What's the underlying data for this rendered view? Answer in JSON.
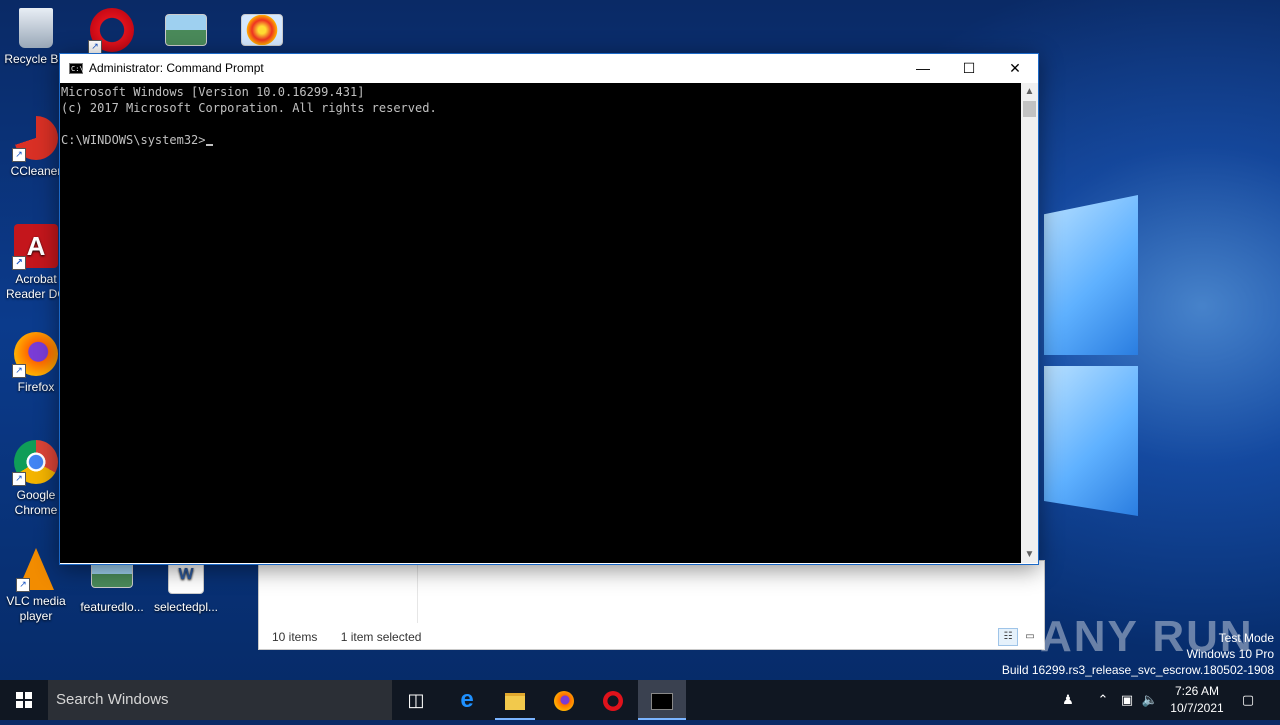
{
  "desktop": {
    "icons": [
      {
        "label": "Recycle Bin",
        "icon": "recycle-bin-icon"
      },
      {
        "label": "CCleaner",
        "icon": "ccleaner-icon"
      },
      {
        "label": "Acrobat Reader DC",
        "icon": "acrobat-reader-icon"
      },
      {
        "label": "Firefox",
        "icon": "firefox-icon"
      },
      {
        "label": "Google Chrome",
        "icon": "chrome-icon"
      },
      {
        "label": "VLC media player",
        "icon": "vlc-icon"
      },
      {
        "label": "featuredlo...",
        "icon": "image-file-icon"
      },
      {
        "label": "selectedpl...",
        "icon": "word-document-icon"
      }
    ]
  },
  "cmd": {
    "title": "Administrator: Command Prompt",
    "line1": "Microsoft Windows [Version 10.0.16299.431]",
    "line2": "(c) 2017 Microsoft Corporation. All rights reserved.",
    "prompt": "C:\\WINDOWS\\system32>"
  },
  "explorer": {
    "items_count": "10 items",
    "selected": "1 item selected"
  },
  "watermark": {
    "brand": "ANY RUN",
    "mode": "Test Mode",
    "edition": "Windows 10 Pro",
    "build": "Build 16299.rs3_release_svc_escrow.180502-1908"
  },
  "taskbar": {
    "search_placeholder": "Search Windows",
    "time": "7:26 AM",
    "date": "10/7/2021"
  }
}
